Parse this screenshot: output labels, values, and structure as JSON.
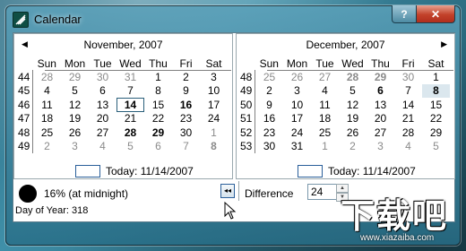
{
  "window": {
    "title": "Calendar",
    "help_label": "?",
    "close_label": "✕"
  },
  "weekday_headers": [
    "Sun",
    "Mon",
    "Tue",
    "Wed",
    "Thu",
    "Fri",
    "Sat"
  ],
  "left_month": {
    "title": "November, 2007",
    "weeks": [
      {
        "wk": "44",
        "days": [
          {
            "d": "28",
            "dim": true
          },
          {
            "d": "29",
            "dim": true
          },
          {
            "d": "30",
            "dim": true
          },
          {
            "d": "31",
            "dim": true
          },
          {
            "d": "1"
          },
          {
            "d": "2"
          },
          {
            "d": "3"
          }
        ]
      },
      {
        "wk": "45",
        "days": [
          {
            "d": "4"
          },
          {
            "d": "5"
          },
          {
            "d": "6"
          },
          {
            "d": "7"
          },
          {
            "d": "8"
          },
          {
            "d": "9"
          },
          {
            "d": "10"
          }
        ]
      },
      {
        "wk": "46",
        "days": [
          {
            "d": "11"
          },
          {
            "d": "12"
          },
          {
            "d": "13"
          },
          {
            "d": "14",
            "bold": true,
            "today": true
          },
          {
            "d": "15"
          },
          {
            "d": "16",
            "bold": true
          },
          {
            "d": "17"
          }
        ]
      },
      {
        "wk": "47",
        "days": [
          {
            "d": "18"
          },
          {
            "d": "19"
          },
          {
            "d": "20"
          },
          {
            "d": "21"
          },
          {
            "d": "22"
          },
          {
            "d": "23"
          },
          {
            "d": "24"
          }
        ]
      },
      {
        "wk": "48",
        "days": [
          {
            "d": "25"
          },
          {
            "d": "26"
          },
          {
            "d": "27"
          },
          {
            "d": "28",
            "bold": true
          },
          {
            "d": "29",
            "bold": true
          },
          {
            "d": "30"
          },
          {
            "d": "1",
            "dim": true
          }
        ]
      },
      {
        "wk": "49",
        "days": [
          {
            "d": "2",
            "dim": true
          },
          {
            "d": "3",
            "dim": true
          },
          {
            "d": "4",
            "dim": true
          },
          {
            "d": "5",
            "dim": true
          },
          {
            "d": "6",
            "dim": true
          },
          {
            "d": "7",
            "dim": true
          },
          {
            "d": "8",
            "dim": true,
            "bold": true
          }
        ]
      }
    ],
    "today_text": "Today: 11/14/2007"
  },
  "right_month": {
    "title": "December, 2007",
    "weeks": [
      {
        "wk": "48",
        "days": [
          {
            "d": "25",
            "dim": true
          },
          {
            "d": "26",
            "dim": true
          },
          {
            "d": "27",
            "dim": true
          },
          {
            "d": "28",
            "dim": true,
            "bold": true
          },
          {
            "d": "29",
            "dim": true,
            "bold": true
          },
          {
            "d": "30",
            "dim": true
          },
          {
            "d": "1"
          }
        ]
      },
      {
        "wk": "49",
        "days": [
          {
            "d": "2"
          },
          {
            "d": "3"
          },
          {
            "d": "4"
          },
          {
            "d": "5"
          },
          {
            "d": "6",
            "bold": true
          },
          {
            "d": "7"
          },
          {
            "d": "8",
            "bold": true,
            "sel": true
          }
        ]
      },
      {
        "wk": "50",
        "days": [
          {
            "d": "9"
          },
          {
            "d": "10"
          },
          {
            "d": "11"
          },
          {
            "d": "12"
          },
          {
            "d": "13"
          },
          {
            "d": "14"
          },
          {
            "d": "15"
          }
        ]
      },
      {
        "wk": "51",
        "days": [
          {
            "d": "16"
          },
          {
            "d": "17"
          },
          {
            "d": "18"
          },
          {
            "d": "19"
          },
          {
            "d": "20"
          },
          {
            "d": "21"
          },
          {
            "d": "22"
          }
        ]
      },
      {
        "wk": "52",
        "days": [
          {
            "d": "23"
          },
          {
            "d": "24"
          },
          {
            "d": "25"
          },
          {
            "d": "26"
          },
          {
            "d": "27"
          },
          {
            "d": "28"
          },
          {
            "d": "29"
          }
        ]
      },
      {
        "wk": "53",
        "days": [
          {
            "d": "30"
          },
          {
            "d": "31"
          },
          {
            "d": "1",
            "dim": true
          },
          {
            "d": "2",
            "dim": true
          },
          {
            "d": "3",
            "dim": true
          },
          {
            "d": "4",
            "dim": true
          },
          {
            "d": "5",
            "dim": true
          }
        ]
      }
    ],
    "today_text": "Today: 11/14/2007"
  },
  "moon": {
    "text": "16% (at midnight)"
  },
  "collapse_label": "◂◂",
  "day_of_year": "Day of Year: 318",
  "difference": {
    "label": "Difference",
    "value": "24"
  },
  "watermark": {
    "big": "下载吧",
    "small": "www.xiazaiba.com"
  },
  "colors": {
    "accent": "#2a5f9a",
    "dim_text": "#8a8a8a",
    "glass": "#3f8fa8"
  }
}
